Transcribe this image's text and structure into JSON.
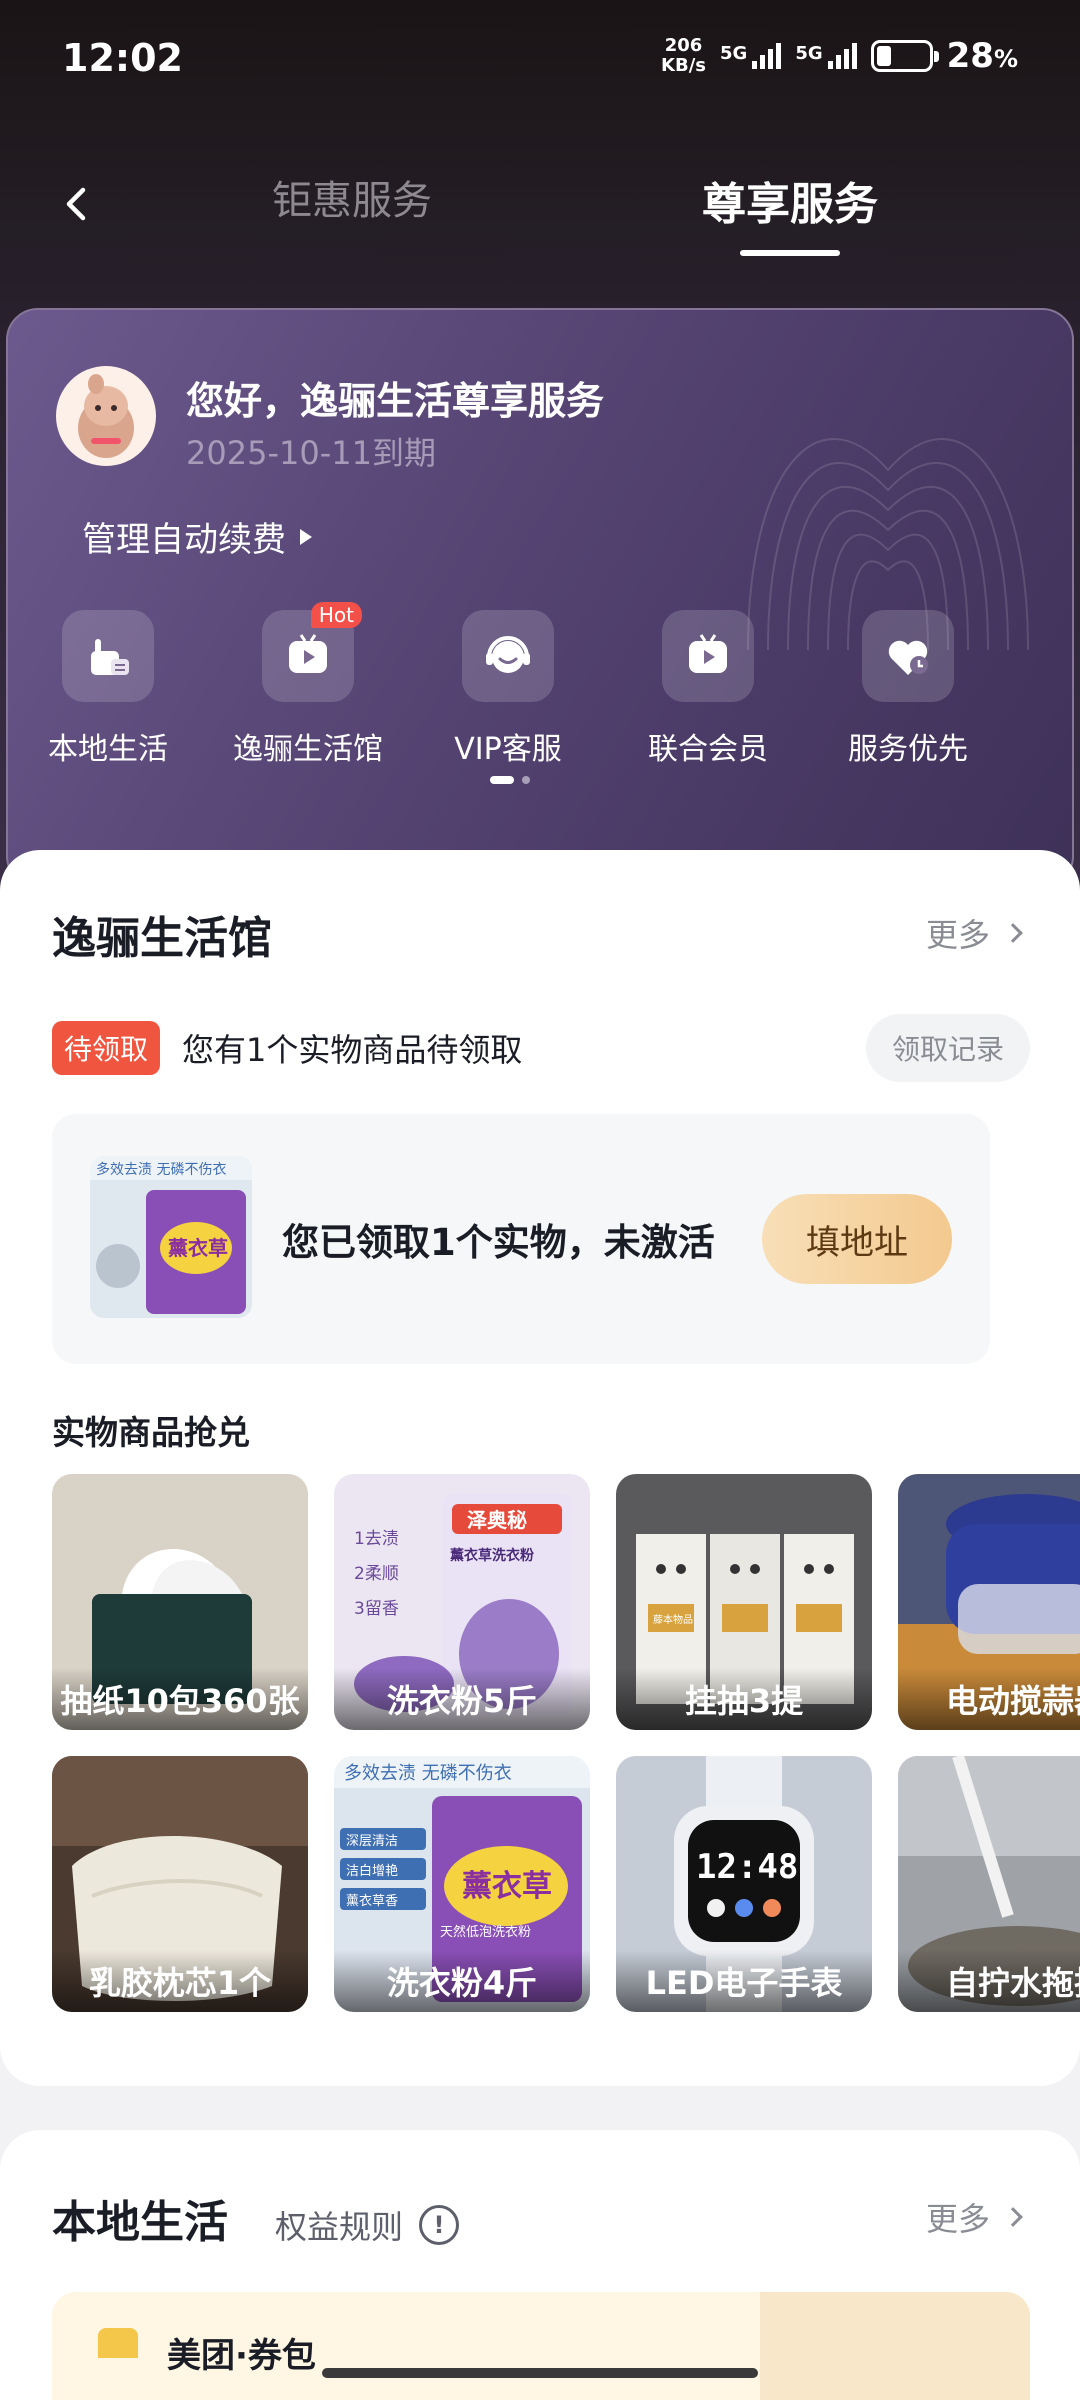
{
  "status_bar": {
    "time": "12:02",
    "speed_value": "206",
    "speed_unit": "KB/s",
    "net1": "5G",
    "net2": "5G",
    "battery": "28",
    "battery_unit": "%"
  },
  "nav": {
    "tabs": [
      {
        "label": "钜惠服务",
        "active": false
      },
      {
        "label": "尊享服务",
        "active": true
      }
    ]
  },
  "member": {
    "greeting": "您好，逸骊生活尊享服务",
    "expiry": "2025-10-11到期",
    "auto_renew": "管理自动续费"
  },
  "services": [
    {
      "label": "本地生活",
      "icon": "local-life-icon"
    },
    {
      "label": "逸骊生活馆",
      "icon": "play-tv-icon",
      "badge": "Hot"
    },
    {
      "label": "VIP客服",
      "icon": "headset-icon"
    },
    {
      "label": "联合会员",
      "icon": "tv-icon"
    },
    {
      "label": "服务优先",
      "icon": "heart-icon"
    }
  ],
  "lifestore": {
    "title": "逸骊生活馆",
    "more": "更多",
    "pending_badge": "待领取",
    "pending_text": "您有1个实物商品待领取",
    "record_btn": "领取记录",
    "gift_msg": "您已领取1个实物，未激活",
    "fill_btn": "填地址",
    "gift_thumb_text": "多效去渍 无磷不伤衣",
    "gift_thumb_brand": "薰衣草",
    "section": "实物商品抢兑",
    "row1": [
      {
        "name": "抽纸10包360张"
      },
      {
        "name": "洗衣粉5斤",
        "pack_brand": "泽奥秘",
        "pack_sub": "薰衣草洗衣粉",
        "tags": [
          "1去渍",
          "2柔顺",
          "3留香"
        ]
      },
      {
        "name": "挂抽3提",
        "pack_label": "藤本物品"
      },
      {
        "name": "电动搅蒜器"
      }
    ],
    "row2": [
      {
        "name": "乳胶枕芯1个"
      },
      {
        "name": "洗衣粉4斤",
        "top_text": "多效去渍 无磷不伤衣",
        "tags": [
          "深层清洁",
          "洁白增艳",
          "薰衣草香"
        ],
        "pack_brand": "薰衣草",
        "pack_sub": "天然低泡洗衣粉"
      },
      {
        "name": "LED电子手表",
        "watch_time": "12:48"
      },
      {
        "name": "自拧水拖把"
      }
    ]
  },
  "local": {
    "title": "本地生活",
    "rules": "权益规则",
    "info_glyph": "!",
    "more": "更多",
    "card_title": "美团·券包"
  },
  "colors": {
    "accent": "#f0553f",
    "button": "#f3c98f",
    "card": "#5a4878"
  }
}
